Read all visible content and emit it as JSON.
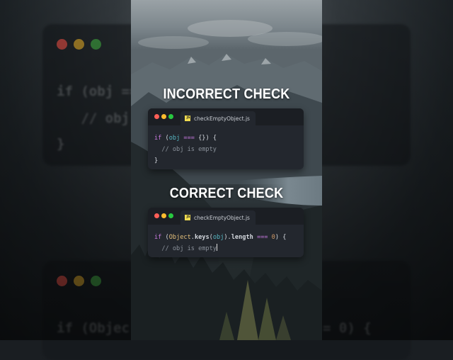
{
  "headings": {
    "incorrect": "INCORRECT CHECK",
    "correct": "CORRECT CHECK"
  },
  "cards": [
    {
      "filename": "checkEmptyObject.js",
      "icon_text": "JS",
      "line1": {
        "if": "if",
        "open": " (",
        "obj": "obj",
        "op": " === ",
        "rest": "{}) {"
      },
      "comment": "  // obj is empty",
      "close": "}"
    },
    {
      "filename": "checkEmptyObject.js",
      "icon_text": "JS",
      "line1": {
        "if": "if",
        "open": " (",
        "object": "Object",
        "dot": ".",
        "keys": "keys",
        "paren": "(",
        "obj": "obj",
        "close_paren": ").",
        "length": "length",
        "op": " === ",
        "num": "0",
        "rest": ") {"
      },
      "comment": "  // obj is empty"
    }
  ],
  "background": {
    "top_code_line1": "if (obj ==",
    "top_code_line2": "   // obj",
    "top_code_line3": "}",
    "bottom_code_line1": "if (Objec",
    "bottom_code_tail": "= 0) {"
  },
  "colors": {
    "keyword": "#c678dd",
    "variable": "#56b6c2",
    "object": "#e5c07b",
    "number": "#d19a66",
    "comment": "#8b929b",
    "card_bg": "#23272e"
  }
}
